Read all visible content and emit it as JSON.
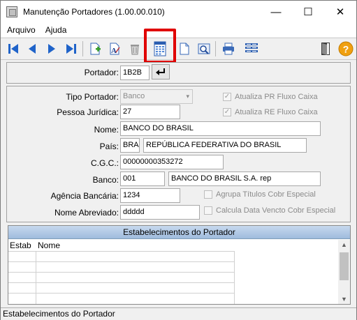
{
  "window": {
    "title": "Manutenção Portadores (1.00.00.010)",
    "minimize": "—",
    "maximize": "☐",
    "close": "✕"
  },
  "menu": {
    "items": [
      "Arquivo",
      "Ajuda"
    ]
  },
  "toolbar": {
    "buttons": [
      "first-record",
      "previous-record",
      "next-record",
      "last-record",
      "new-record",
      "edit-record",
      "delete-record",
      "calendar-grid",
      "blank-document",
      "preview",
      "print",
      "list-view",
      "exit",
      "help"
    ],
    "help_label": "?",
    "highlight_color": "#e00000"
  },
  "form": {
    "portador": {
      "label": "Portador:",
      "value": "1B2B"
    },
    "tipo_portador": {
      "label": "Tipo Portador:",
      "value": "Banco"
    },
    "pessoa_juridica": {
      "label": "Pessoa Jurídica:",
      "value": "27"
    },
    "nome": {
      "label": "Nome:",
      "value": "BANCO DO BRASIL"
    },
    "pais": {
      "label": "País:",
      "code": "BRA",
      "name": "REPÚBLICA FEDERATIVA DO BRASIL"
    },
    "cgc": {
      "label": "C.G.C.:",
      "value": "00000000353272"
    },
    "banco": {
      "label": "Banco:",
      "code": "001",
      "name": "BANCO DO BRASIL S.A. rep"
    },
    "agencia": {
      "label": "Agência Bancária:",
      "value": "1234"
    },
    "nome_abreviado": {
      "label": "Nome Abreviado:",
      "value": "ddddd"
    },
    "checkboxes": {
      "atualiza_pr": {
        "label": "Atualiza PR Fluxo Caixa",
        "checked": true
      },
      "atualiza_re": {
        "label": "Atualiza RE Fluxo Caixa",
        "checked": true
      },
      "agrupa": {
        "label": "Agrupa Títulos Cobr Especial",
        "checked": false
      },
      "calcula": {
        "label": "Calcula Data Vencto Cobr Especial",
        "checked": false
      }
    }
  },
  "grid": {
    "title": "Estabelecimentos do Portador",
    "columns": [
      "Estab",
      "Nome"
    ],
    "rows": []
  },
  "status": {
    "text": "Estabelecimentos do Portador"
  }
}
